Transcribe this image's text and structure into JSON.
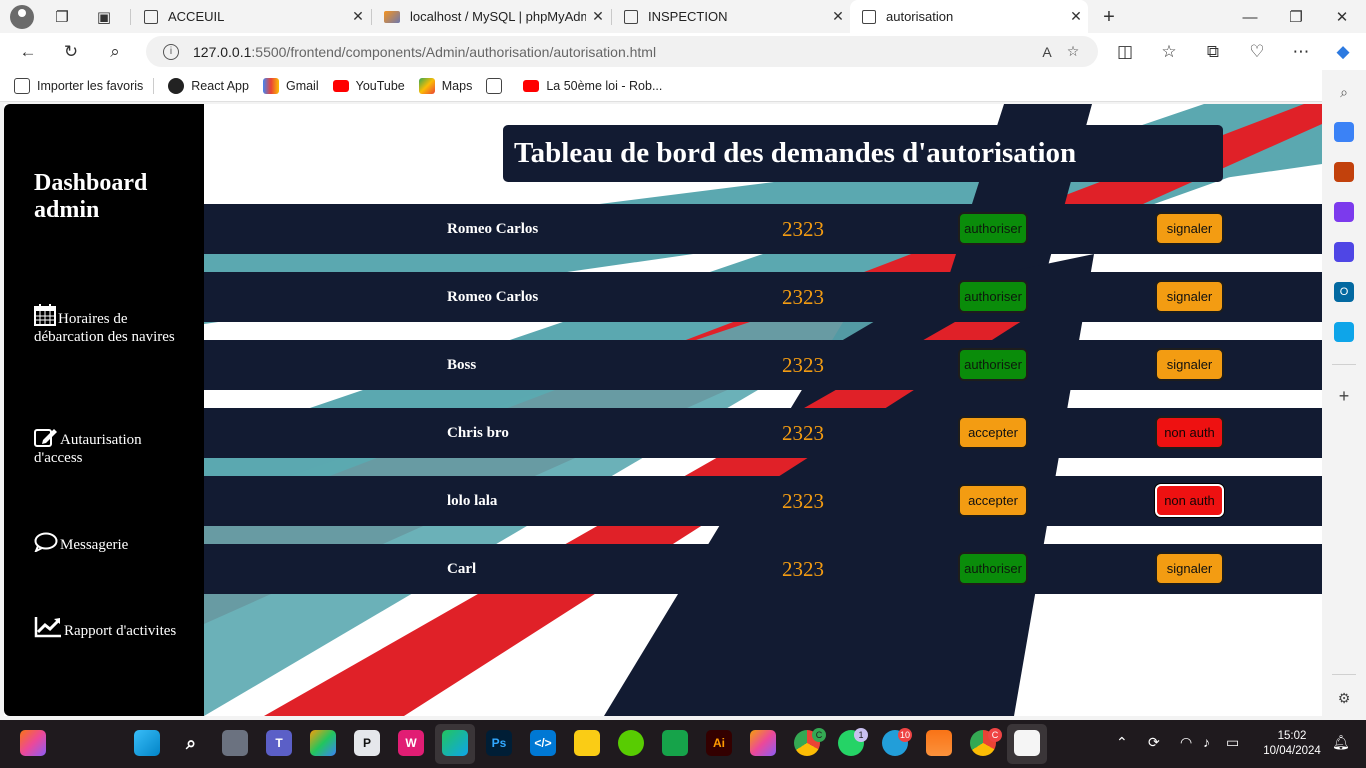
{
  "browser": {
    "tabs": [
      {
        "label": "ACCEUIL"
      },
      {
        "label": "localhost / MySQL | phpMyAdmin"
      },
      {
        "label": "INSPECTION"
      },
      {
        "label": "autorisation"
      }
    ],
    "url_host": "127.0.0.1",
    "url_rest": ":5500/frontend/components/Admin/authorisation/autorisation.html",
    "favorites": [
      "Importer les favoris",
      "React App",
      "Gmail",
      "YouTube",
      "Maps",
      "La 50ème loi - Rob..."
    ]
  },
  "sidebar": {
    "title": "Dashboard admin",
    "items": [
      {
        "label": "Horaires de débarcation des navires",
        "icon": "calendar-icon"
      },
      {
        "label": "Autaurisation d'access",
        "icon": "edit-icon"
      },
      {
        "label": "Messagerie",
        "icon": "chat-bubble-icon"
      },
      {
        "label": "Rapport d'activites",
        "icon": "line-chart-icon"
      }
    ]
  },
  "header": {
    "title": "Tableau de bord des demandes d'autorisation"
  },
  "rows": [
    {
      "name": "Romeo Carlos",
      "number": "2323",
      "btn1": "authoriser",
      "btn2": "signaler"
    },
    {
      "name": "Romeo Carlos",
      "number": "2323",
      "btn1": "authoriser",
      "btn2": "signaler"
    },
    {
      "name": "Boss",
      "number": "2323",
      "btn1": "authoriser",
      "btn2": "signaler"
    },
    {
      "name": "Chris bro",
      "number": "2323",
      "btn1": "accepter",
      "btn2": "non auth"
    },
    {
      "name": "lolo lala",
      "number": "2323",
      "btn1": "accepter",
      "btn2": "non auth"
    },
    {
      "name": "Carl",
      "number": "2323",
      "btn1": "authoriser",
      "btn2": "signaler"
    }
  ],
  "colors": {
    "navy": "#121b32",
    "accent_orange": "#f39c12",
    "green": "#0a8c0a",
    "red": "#ee1111",
    "teal": "#5ba8b0"
  },
  "taskbar": {
    "time": "15:02",
    "date": "10/04/2024",
    "badges": {
      "chrome": "C",
      "whatsapp": "1",
      "telegram": "10",
      "chrome2": "C"
    }
  }
}
